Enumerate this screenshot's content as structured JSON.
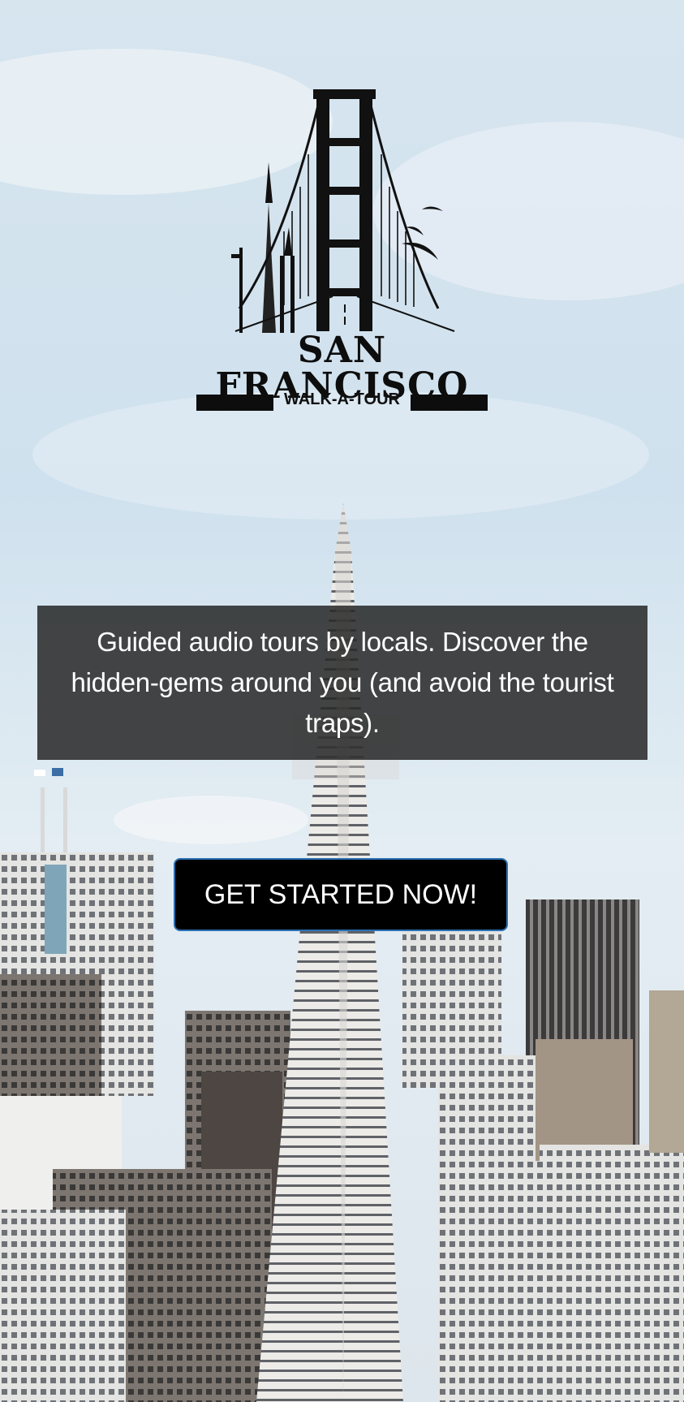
{
  "logo": {
    "title": "SAN FRANCISCO",
    "subtitle": "WALK-A-TOUR"
  },
  "tagline": "Guided audio tours by locals. Discover the hidden-gems around you (and avoid the tourist traps).",
  "cta": {
    "label": "GET STARTED NOW!"
  },
  "colors": {
    "sky": "#cfe0ec",
    "panel": "#282828",
    "button": "#000000",
    "button_border": "#2b6fb3"
  }
}
